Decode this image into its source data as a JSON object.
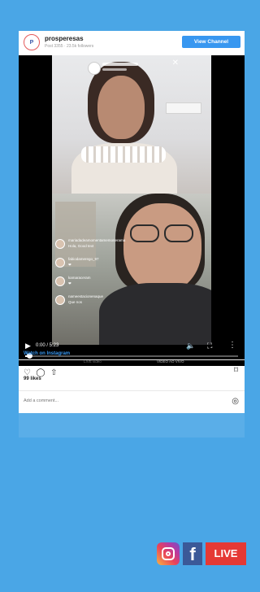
{
  "post": {
    "username": "prosperesas",
    "subtitle": "Post 3355 · 23.5k followers",
    "view_button": "View Channel",
    "watch_link": "Watch on Instagram",
    "likes": "99 likes",
    "comment_placeholder": "Add a comment..."
  },
  "video": {
    "time": "0:00 / 5:23",
    "tab_left": "LIVE video",
    "tab_right": "VIDEO AO VIVO",
    "progress_fraction": 0.02
  },
  "comments": [
    {
      "user": "mariadadeamomentamemonerama",
      "text": "Hola, Good text"
    },
    {
      "user": "fabiodamerego_97",
      "text": "❤"
    },
    {
      "user": "kamaraceram",
      "text": "❤"
    },
    {
      "user": "nameestacionenaque",
      "text": "Que nos"
    }
  ],
  "badges": {
    "live_label": "LIVE",
    "fb_letter": "f"
  },
  "colors": {
    "background": "#4aa6e6",
    "button": "#3897f0",
    "live_red": "#e53935",
    "facebook": "#3b5998"
  }
}
